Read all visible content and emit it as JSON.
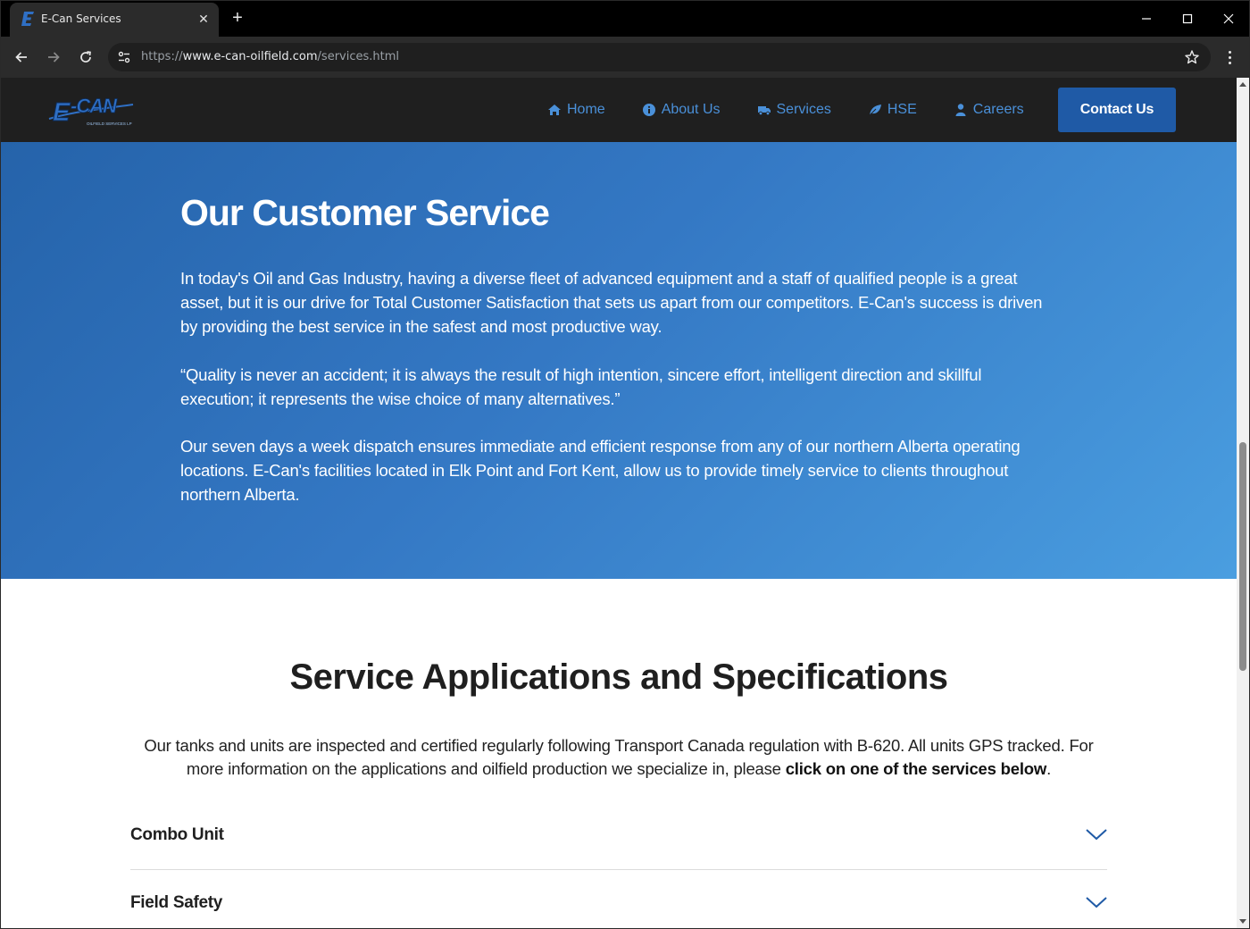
{
  "browser": {
    "tab_title": "E-Can Services",
    "url_prefix": "https://",
    "url_host": "www.e-can-oilfield.com",
    "url_path": "/services.html"
  },
  "site": {
    "logo_text": "E-CAN",
    "logo_subtext": "OILFIELD SERVICES LP",
    "nav": [
      {
        "label": "Home",
        "icon": "home-icon"
      },
      {
        "label": "About Us",
        "icon": "info-icon"
      },
      {
        "label": "Services",
        "icon": "truck-icon"
      },
      {
        "label": "HSE",
        "icon": "leaf-icon"
      },
      {
        "label": "Careers",
        "icon": "user-icon"
      }
    ],
    "contact_label": "Contact Us",
    "colors": {
      "header_bg": "#1f1f1f",
      "nav_link": "#4a90d9",
      "button_bg": "#1f5aa6",
      "hero_from": "#2563aa",
      "hero_to": "#4a9ee0"
    }
  },
  "hero": {
    "title": "Our Customer Service",
    "paragraphs": [
      "In today's Oil and Gas Industry, having a diverse fleet of advanced equipment and a staff of qualified people is a great asset, but it is our drive for Total Customer Satisfaction that sets us apart from our competitors. E-Can's success is driven by providing the best service in the safest and most productive way.",
      "“Quality is never an accident; it is always the result of high intention, sincere effort, intelligent direction and skillful execution; it represents the wise choice of many alternatives.”",
      "Our seven days a week dispatch ensures immediate and efficient response from any of our northern Alberta operating locations. E-Can's facilities located in Elk Point and Fort Kent, allow us to provide timely service to clients throughout northern Alberta."
    ]
  },
  "services": {
    "title": "Service Applications and Specifications",
    "intro_text": "Our tanks and units are inspected and certified regularly following Transport Canada regulation with B-620. All units GPS tracked. For more information on the applications and oilfield production we specialize in, please ",
    "intro_bold": "click on one of the services below",
    "intro_end": ".",
    "accordion": [
      "Combo Unit",
      "Field Safety"
    ]
  }
}
